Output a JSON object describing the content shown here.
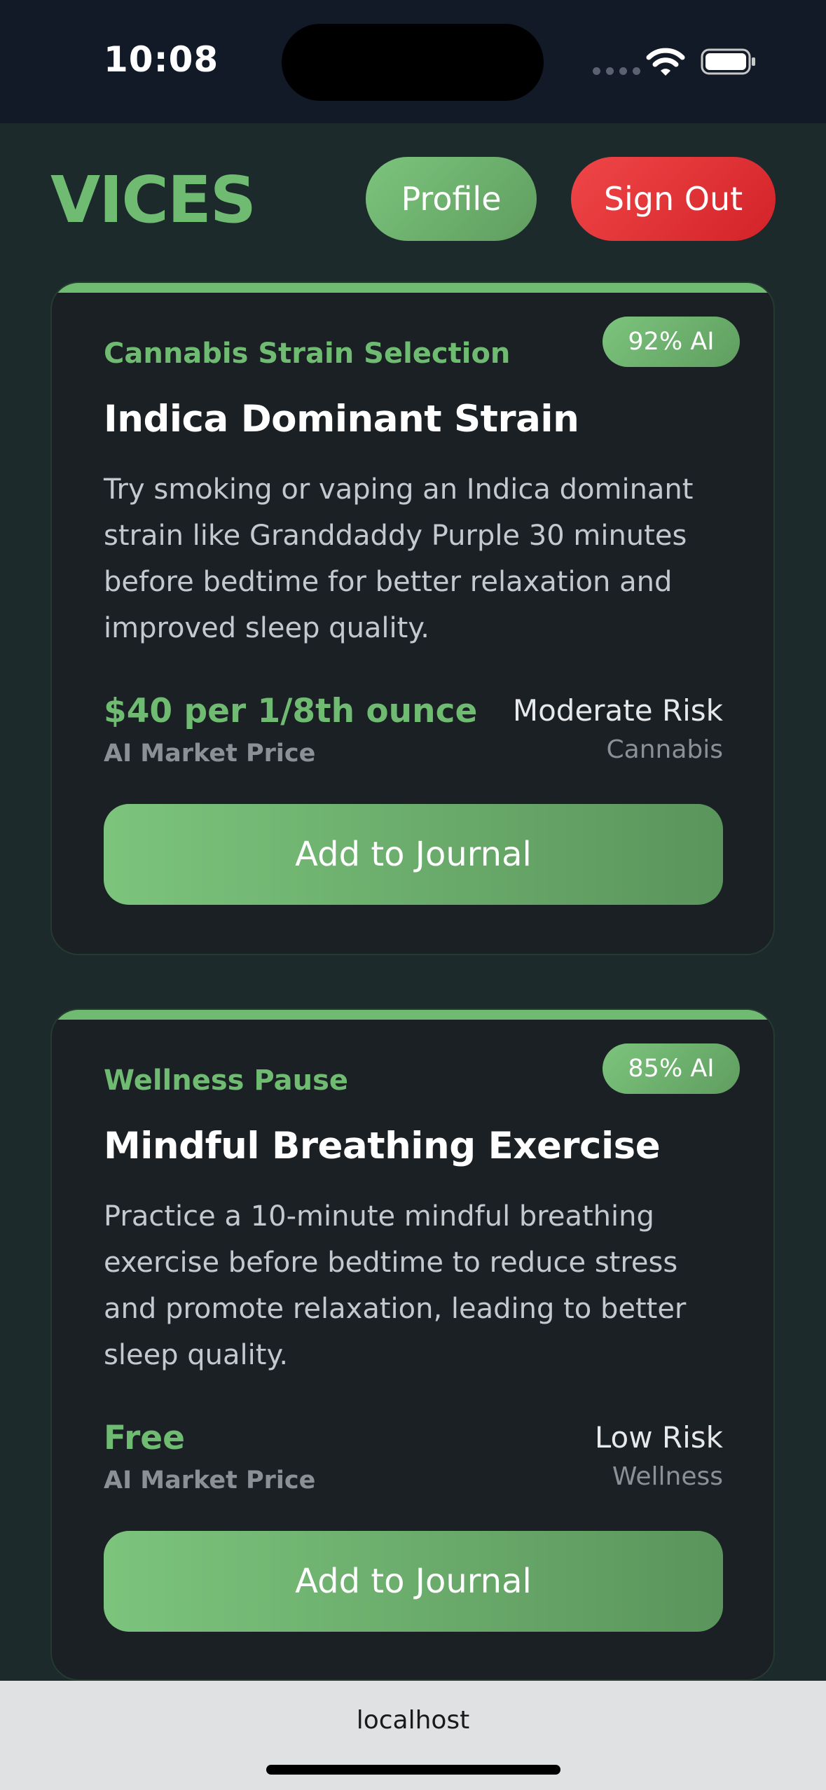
{
  "status_bar": {
    "time": "10:08",
    "icons": [
      "signal-dots-icon",
      "wifi-icon",
      "battery-icon"
    ]
  },
  "header": {
    "logo": "VICES",
    "profile_label": "Profile",
    "signout_label": "Sign Out"
  },
  "cards": [
    {
      "badge": "92% AI",
      "category": "Cannabis Strain Selection",
      "title": "Indica Dominant Strain",
      "description": "Try smoking or vaping an Indica dominant strain like Granddaddy Purple 30 minutes before bedtime for better relaxation and improved sleep quality.",
      "price": "$40 per 1/8th ounce",
      "price_label": "AI Market Price",
      "risk": "Moderate Risk",
      "risk_category": "Cannabis",
      "button_label": "Add to Journal"
    },
    {
      "badge": "85% AI",
      "category": "Wellness Pause",
      "title": "Mindful Breathing Exercise",
      "description": "Practice a 10-minute mindful breathing exercise before bedtime to reduce stress and promote relaxation, leading to better sleep quality.",
      "price": "Free",
      "price_label": "AI Market Price",
      "risk": "Low Risk",
      "risk_category": "Wellness",
      "button_label": "Add to Journal"
    }
  ],
  "browser": {
    "url": "localhost"
  },
  "colors": {
    "accent_green": "#6fbb72",
    "danger_red": "#e33437",
    "background": "#1d2a2b",
    "card_background": "#1a2024",
    "status_bar_background": "#121a28"
  }
}
